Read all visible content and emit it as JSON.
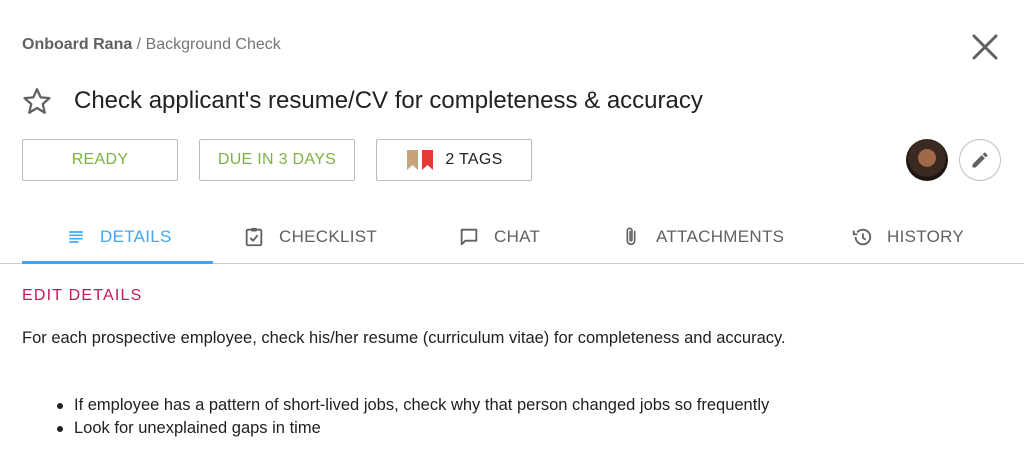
{
  "breadcrumb": {
    "parent": "Onboard Rana",
    "separator": " / ",
    "current": "Background Check"
  },
  "task": {
    "title": "Check applicant's resume/CV for completeness & accuracy"
  },
  "chips": {
    "status": "READY",
    "due": "DUE IN 3 DAYS",
    "tags": "2 TAGS"
  },
  "tabs": [
    {
      "label": "DETAILS",
      "icon": "details-icon"
    },
    {
      "label": "CHECKLIST",
      "icon": "checklist-icon"
    },
    {
      "label": "CHAT",
      "icon": "chat-icon"
    },
    {
      "label": "ATTACHMENTS",
      "icon": "attachment-icon"
    },
    {
      "label": "HISTORY",
      "icon": "history-icon"
    }
  ],
  "details": {
    "edit_label": "EDIT DETAILS",
    "description": "For each prospective employee, check his/her resume (curriculum vitae) for completeness and accuracy.",
    "bullets": [
      "If employee has a pattern of short-lived jobs, check why that person changed jobs so frequently",
      "Look for unexplained gaps in time"
    ]
  },
  "colors": {
    "accent": "#42a5f5",
    "ready_green": "#7cb342",
    "edit_link": "#c2185b",
    "tag_tan": "#c8a27a",
    "tag_red": "#e53935"
  }
}
